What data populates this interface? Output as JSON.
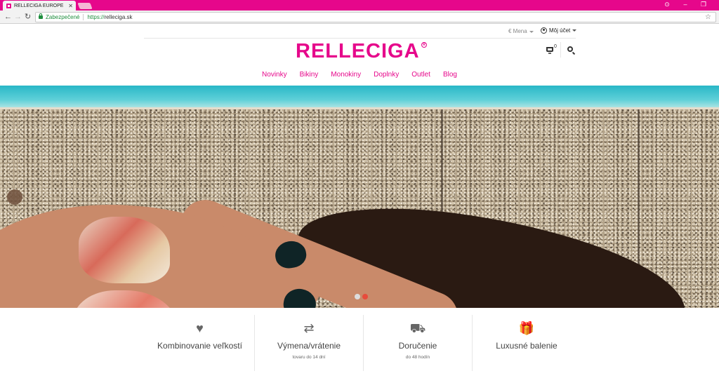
{
  "browser": {
    "tab_title": "RELLECIGA EUROPE",
    "tab_close": "✕",
    "secure_label": "Zabezpečené",
    "url_scheme": "https://",
    "url_host": "relleciga.sk",
    "back": "←",
    "forward": "→",
    "reload": "↻",
    "star": "☆",
    "window_controls": {
      "minimize": "–",
      "restore": "❐",
      "close": "✕",
      "profile": "⊙"
    },
    "theme_color": "#e6078b"
  },
  "topbar": {
    "currency_label": "€ Mena",
    "account_label": "Môj účet"
  },
  "header": {
    "logo_text": "RELLECIGA",
    "registered_mark": "R",
    "cart_count": "0"
  },
  "nav": {
    "items": [
      {
        "label": "Novinky"
      },
      {
        "label": "Bikiny"
      },
      {
        "label": "Monokiny"
      },
      {
        "label": "Doplnky"
      },
      {
        "label": "Outlet"
      },
      {
        "label": "Blog"
      }
    ]
  },
  "hero": {
    "slide_count": 2,
    "active_slide": 2,
    "dot_inactive_color": "#dddddd",
    "dot_active_color": "#e74c3c"
  },
  "features": [
    {
      "icon": "heart-icon",
      "glyph": "♥",
      "title": "Kombinovanie veľkostí",
      "subtitle": ""
    },
    {
      "icon": "exchange-icon",
      "glyph": "⇄",
      "title": "Výmena/vrátenie",
      "subtitle": "tovaru do 14 dní"
    },
    {
      "icon": "truck-icon",
      "glyph": "⛟",
      "title": "Doručenie",
      "subtitle": "do 48 hodín"
    },
    {
      "icon": "gift-icon",
      "glyph": "🎁",
      "title": "Luxusné balenie",
      "subtitle": ""
    }
  ]
}
